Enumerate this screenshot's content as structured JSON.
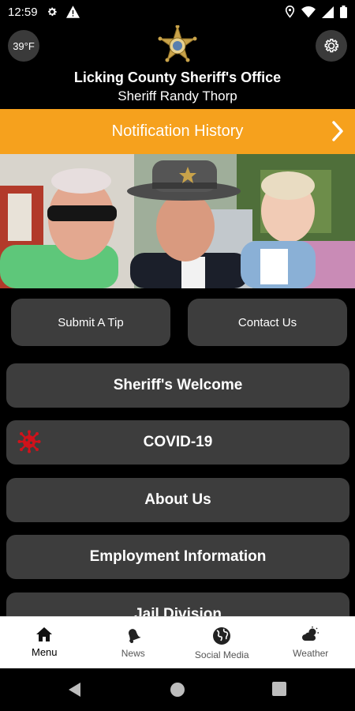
{
  "status_bar": {
    "time": "12:59"
  },
  "header": {
    "temperature": "39°F",
    "org_name": "Licking County Sheriff's Office",
    "sheriff_name": "Sheriff Randy Thorp"
  },
  "notification_bar": {
    "label": "Notification History"
  },
  "actions": {
    "submit_tip": "Submit A Tip",
    "contact_us": "Contact Us"
  },
  "menu_items": [
    {
      "label": "Sheriff's Welcome"
    },
    {
      "label": "COVID-19",
      "icon": "virus-icon"
    },
    {
      "label": "About Us"
    },
    {
      "label": "Employment Information"
    },
    {
      "label": "Jail Division"
    }
  ],
  "tabs": [
    {
      "label": "Menu",
      "icon": "home-icon",
      "active": true
    },
    {
      "label": "News",
      "icon": "bell-icon",
      "active": false
    },
    {
      "label": "Social Media",
      "icon": "globe-icon",
      "active": false
    },
    {
      "label": "Weather",
      "icon": "weather-icon",
      "active": false
    }
  ],
  "colors": {
    "accent": "#f6a11d",
    "button_bg": "#3d3d3d",
    "covid_icon": "#d0121b"
  }
}
